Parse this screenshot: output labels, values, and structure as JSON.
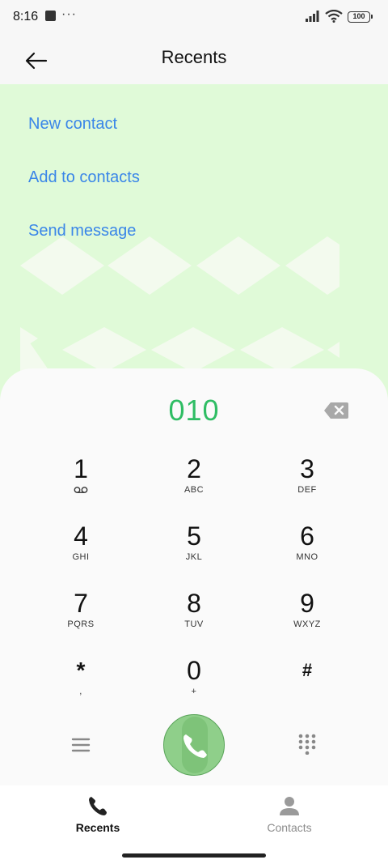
{
  "status_bar": {
    "time": "8:16",
    "more": "···",
    "battery": "100"
  },
  "header": {
    "title": "Recents",
    "back_icon": "arrow-left-icon"
  },
  "actions": [
    {
      "label": "New contact"
    },
    {
      "label": "Add to contacts"
    },
    {
      "label": "Send message"
    }
  ],
  "dialer": {
    "number": "010",
    "keys": [
      {
        "digit": "1",
        "sub": "",
        "sub_icon": "voicemail-icon"
      },
      {
        "digit": "2",
        "sub": "ABC"
      },
      {
        "digit": "3",
        "sub": "DEF"
      },
      {
        "digit": "4",
        "sub": "GHI"
      },
      {
        "digit": "5",
        "sub": "JKL"
      },
      {
        "digit": "6",
        "sub": "MNO"
      },
      {
        "digit": "7",
        "sub": "PQRS"
      },
      {
        "digit": "8",
        "sub": "TUV"
      },
      {
        "digit": "9",
        "sub": "WXYZ"
      },
      {
        "digit": "*",
        "sub": ","
      },
      {
        "digit": "0",
        "sub": "+"
      },
      {
        "digit": "#",
        "sub": ""
      }
    ]
  },
  "nav": [
    {
      "label": "Recents",
      "icon": "phone-icon",
      "active": true
    },
    {
      "label": "Contacts",
      "icon": "person-icon",
      "active": false
    }
  ],
  "colors": {
    "accent_green": "#2fbd64",
    "link_blue": "#3a86e8",
    "panel_green": "#e0fad8"
  }
}
